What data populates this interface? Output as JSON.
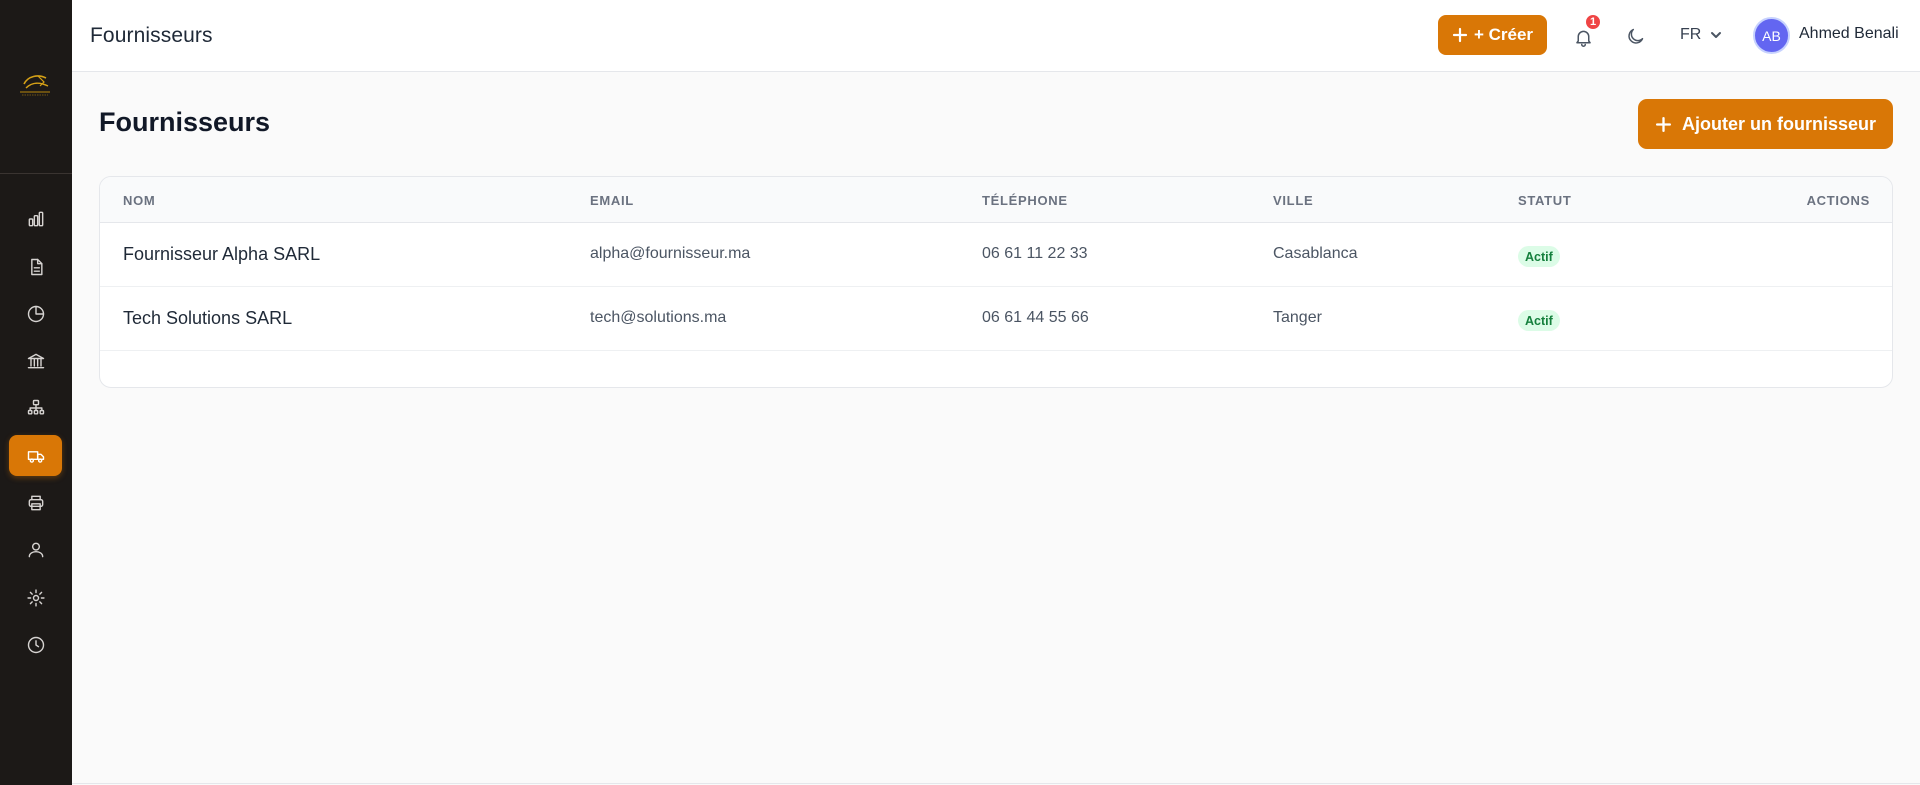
{
  "header": {
    "title": "Fournisseurs",
    "create_label": "+ Créer",
    "notification_count": "1",
    "language": "FR",
    "avatar_initials": "AB",
    "user_name": "Ahmed Benali"
  },
  "page": {
    "title": "Fournisseurs",
    "add_label": "Ajouter un fournisseur"
  },
  "table": {
    "columns": [
      "NOM",
      "EMAIL",
      "TÉLÉPHONE",
      "VILLE",
      "STATUT",
      "ACTIONS"
    ],
    "rows": [
      {
        "name": "Fournisseur Alpha SARL",
        "email": "alpha@fournisseur.ma",
        "phone": "06 61 11 22 33",
        "city": "Casablanca",
        "status": "Actif"
      },
      {
        "name": "Tech Solutions SARL",
        "email": "tech@solutions.ma",
        "phone": "06 61 44 55 66",
        "city": "Tanger",
        "status": "Actif"
      }
    ]
  },
  "sidebar": {
    "icons": [
      "bar-chart-icon",
      "document-icon",
      "pie-chart-icon",
      "bank-icon",
      "network-icon",
      "truck-icon",
      "printer-icon",
      "users-icon",
      "gear-icon",
      "clock-icon"
    ],
    "active": "truck-icon"
  },
  "colors": {
    "accent": "#d97706",
    "sidebar_bg": "#1c1917",
    "status_bg": "#dcfce7",
    "status_text": "#15803d",
    "notification": "#ef4444",
    "avatar": "#6366f1"
  }
}
